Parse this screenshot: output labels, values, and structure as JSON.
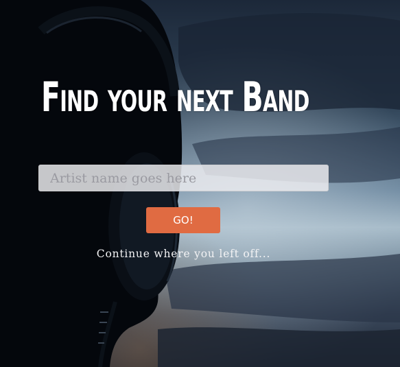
{
  "hero": {
    "title": "Find your next Band",
    "search": {
      "placeholder": "Artist name goes here",
      "value": ""
    },
    "go_label": "GO!",
    "continue_label": "Continue where you left off..."
  },
  "colors": {
    "accent": "#e06b42",
    "sky_top": "#1e2a3c",
    "sky_glow": "#9fb6c8",
    "silhouette": "#04070c"
  },
  "icons": {
    "background": "silhouette-with-headphones-photo"
  }
}
